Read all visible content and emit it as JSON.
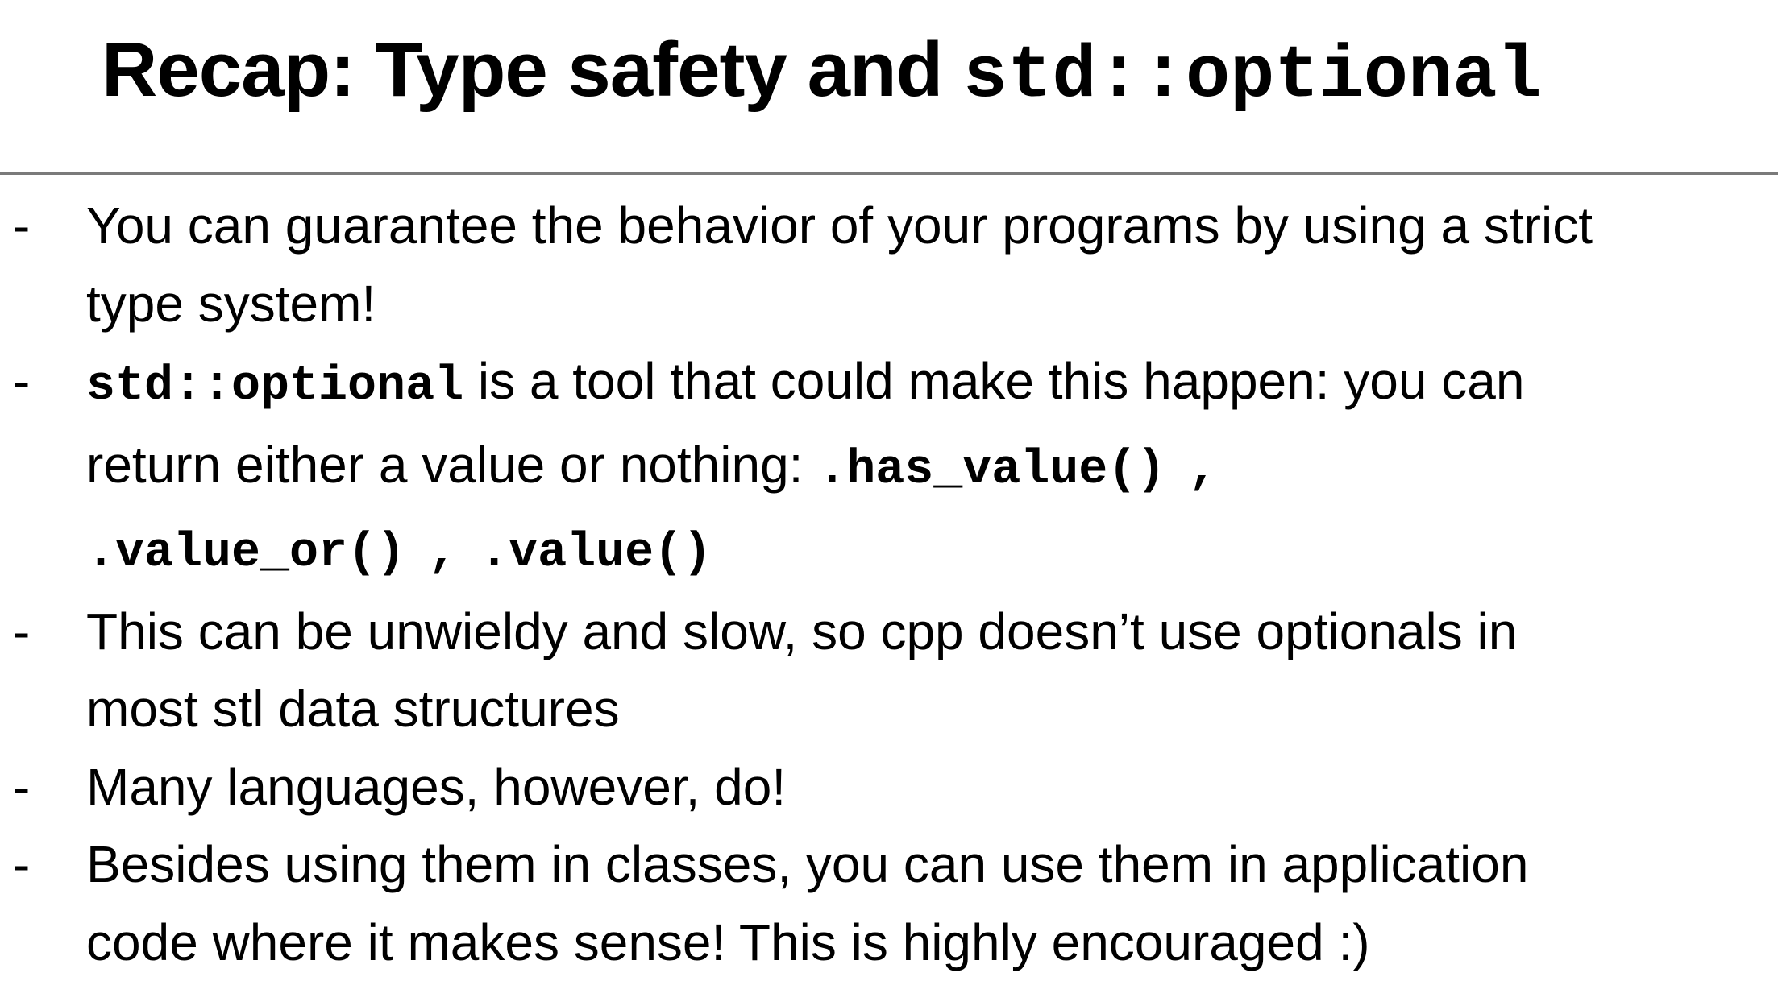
{
  "slide": {
    "title_prefix": "Recap: Type safety and ",
    "title_code": "std::optional",
    "bullet_marker": "-",
    "bullets": [
      {
        "lines": [
          "You can guarantee the behavior of your programs by using a strict",
          "type system!"
        ]
      },
      {
        "code": "std::optional",
        "line1_text": " is a tool that could make this happen: you can",
        "line2_text": "return either a value or nothing: ",
        "methods": [
          ".has_value()",
          ".value_or()",
          ".value()"
        ],
        "separator": ","
      },
      {
        "lines": [
          "This can be unwieldy and slow, so cpp doesn’t use optionals in",
          "most stl data structures"
        ]
      },
      {
        "lines": [
          "Many languages, however, do!"
        ]
      },
      {
        "lines": [
          "Besides using them in classes, you can use them in application",
          "code where it makes sense! This is highly encouraged :)"
        ]
      }
    ]
  }
}
